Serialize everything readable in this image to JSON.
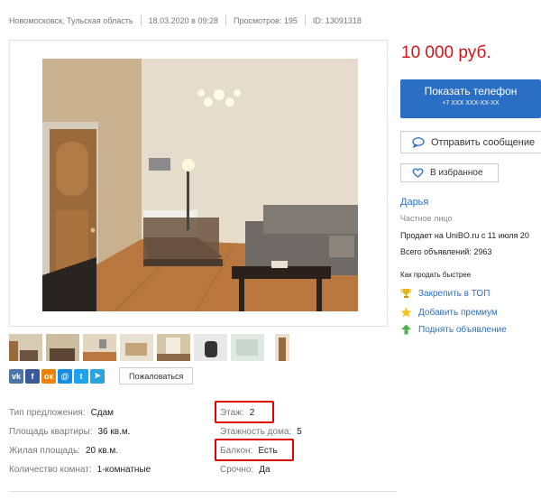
{
  "meta": {
    "location": "Новомосковск, Тульская область",
    "date": "18.03.2020 в 09:28",
    "views": "Просмотров: 195",
    "id": "ID: 13091318"
  },
  "price": "10 000 руб.",
  "actions": {
    "show_phone": "Показать телефон",
    "phone_masked": "+7 XXX XXX-XX-XX",
    "send_message": "Отправить сообщение",
    "favorite": "В избранное"
  },
  "seller": {
    "name": "Дарья",
    "type": "Частное лицо",
    "since": "Продает на UniBO.ru с 11 июля 20",
    "count": "Всего объявлений: 2963"
  },
  "promote": {
    "title": "Как продать быстрее",
    "items": [
      {
        "label": "Закрепить в ТОП",
        "icon": "trophy-icon"
      },
      {
        "label": "Добавить премиум",
        "icon": "star-icon"
      },
      {
        "label": "Поднять объявление",
        "icon": "arrow-up-icon"
      }
    ]
  },
  "share": {
    "buttons": [
      {
        "name": "vk",
        "glyph": "vk",
        "color": "#4a76a8"
      },
      {
        "name": "facebook",
        "glyph": "f",
        "color": "#3b5998"
      },
      {
        "name": "odnoklassniki",
        "glyph": "ок",
        "color": "#ee8208"
      },
      {
        "name": "moimir",
        "glyph": "@",
        "color": "#168de2"
      },
      {
        "name": "twitter",
        "glyph": "t",
        "color": "#1da1f2"
      },
      {
        "name": "telegram",
        "glyph": "➤",
        "color": "#2aa3df"
      }
    ],
    "complain": "Пожаловаться"
  },
  "params": {
    "offer_type": {
      "label": "Тип предложения:",
      "value": "Сдам"
    },
    "area": {
      "label": "Площадь квартиры:",
      "value": "36 кв.м."
    },
    "living_area": {
      "label": "Жилая площадь:",
      "value": "20 кв.м."
    },
    "rooms": {
      "label": "Количество комнат:",
      "value": "1-комнатные"
    },
    "floor": {
      "label": "Этаж:",
      "value": "2"
    },
    "floors": {
      "label": "Этажность дома:",
      "value": "5"
    },
    "balcony": {
      "label": "Балкон:",
      "value": "Есть"
    },
    "urgent": {
      "label": "Срочно:",
      "value": "Да"
    }
  },
  "colors": {
    "accent": "#2b6fc4",
    "price": "#d4141a",
    "highlight": "#e00000"
  }
}
